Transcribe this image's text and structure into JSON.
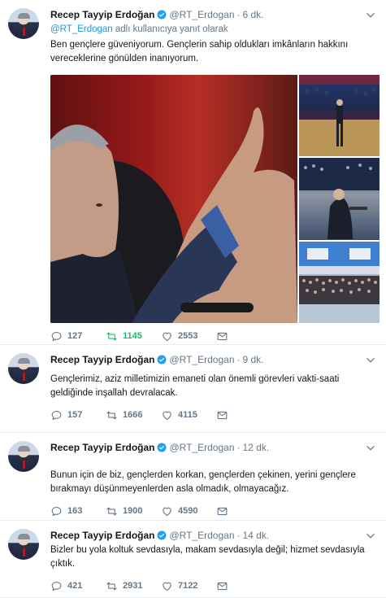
{
  "tweets": [
    {
      "name": "Recep Tayyip Erdoğan",
      "handle": "@RT_Erdogan",
      "dot": "·",
      "time": "6 dk.",
      "reply_mention": "@RT_Erdogan",
      "reply_suffix": "adlı kullanıcıya yanıt olarak",
      "text": "Ben gençlere güveniyorum. Gençlerin sahip oldukları imkânların hakkını vereceklerine gönülden inanıyorum.",
      "replies": "127",
      "retweets": "1145",
      "likes": "2553",
      "retweeted": true,
      "media_count": 4
    },
    {
      "name": "Recep Tayyip Erdoğan",
      "handle": "@RT_Erdogan",
      "dot": "·",
      "time": "9 dk.",
      "text": "Gençlerimiz, aziz milletimizin emaneti olan önemli görevleri vakti-saati geldiğinde inşallah devralacak.",
      "replies": "157",
      "retweets": "1666",
      "likes": "4115"
    },
    {
      "name": "Recep Tayyip Erdoğan",
      "handle": "@RT_Erdogan",
      "dot": "·",
      "time": "12 dk.",
      "text": "Bunun için de biz, gençlerden korkan, gençlerden çekinen, yerini gençlere bırakmayı düşünmeyenlerden asla olmadık, olmayacağız.",
      "replies": "163",
      "retweets": "1900",
      "likes": "4590"
    },
    {
      "name": "Recep Tayyip Erdoğan",
      "handle": "@RT_Erdogan",
      "dot": "·",
      "time": "14 dk.",
      "text": "Bizler bu yola koltuk sevdasıyla, makam sevdasıyla değil; hizmet sevdasıyla çıktık.",
      "replies": "421",
      "retweets": "2931",
      "likes": "7122"
    }
  ],
  "icons": {
    "verified": "verified-badge-icon",
    "caret": "chevron-down-icon",
    "reply": "reply-icon",
    "retweet": "retweet-icon",
    "like": "heart-icon",
    "message": "direct-message-icon"
  },
  "colors": {
    "link": "#1b95e0",
    "muted": "#657786",
    "retweet_active": "#17bf63",
    "verified": "#1da1f2"
  }
}
